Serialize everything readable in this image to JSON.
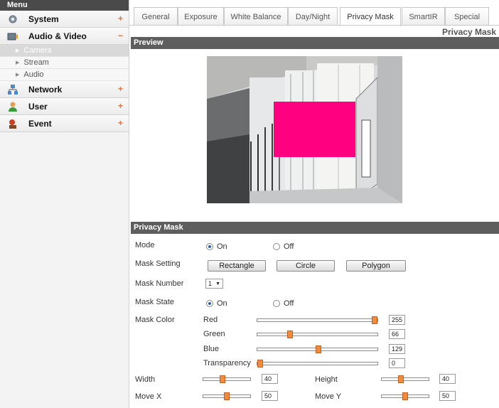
{
  "menu": {
    "header": "Menu",
    "categories": [
      {
        "label": "System",
        "toggle": "+"
      },
      {
        "label": "Audio & Video",
        "toggle": "−"
      },
      {
        "label": "Network",
        "toggle": "+"
      },
      {
        "label": "User",
        "toggle": "+"
      },
      {
        "label": "Event",
        "toggle": "+"
      }
    ],
    "sub_items": [
      {
        "label": "Camera",
        "active": true
      },
      {
        "label": "Stream",
        "active": false
      },
      {
        "label": "Audio",
        "active": false
      }
    ]
  },
  "tabs": [
    {
      "label": "General",
      "active": false
    },
    {
      "label": "Exposure",
      "active": false
    },
    {
      "label": "White Balance",
      "active": false
    },
    {
      "label": "Day/Night",
      "active": false
    },
    {
      "label": "Privacy Mask",
      "active": true
    },
    {
      "label": "SmartIR",
      "active": false
    },
    {
      "label": "Special",
      "active": false
    }
  ],
  "page_title": "Privacy Mask",
  "preview": {
    "title": "Preview",
    "mask_color": "#ff0080"
  },
  "privacy_mask": {
    "title": "Privacy Mask",
    "mode": {
      "label": "Mode",
      "on_label": "On",
      "off_label": "Off",
      "selected": "On"
    },
    "mask_setting": {
      "label": "Mask Setting",
      "buttons": [
        "Rectangle",
        "Circle",
        "Polygon"
      ]
    },
    "mask_number": {
      "label": "Mask Number",
      "value": "1"
    },
    "mask_state": {
      "label": "Mask State",
      "on_label": "On",
      "off_label": "Off",
      "selected": "On"
    },
    "mask_color": {
      "label": "Mask Color",
      "channels": [
        {
          "label": "Red",
          "value": "255",
          "fraction": 1.0
        },
        {
          "label": "Green",
          "value": "66",
          "fraction": 0.26
        },
        {
          "label": "Blue",
          "value": "129",
          "fraction": 0.51
        },
        {
          "label": "Transparency",
          "value": "0",
          "fraction": 0.0
        }
      ]
    },
    "width": {
      "label": "Width",
      "value": "40",
      "fraction": 0.4
    },
    "height": {
      "label": "Height",
      "value": "40",
      "fraction": 0.4
    },
    "move_x": {
      "label": "Move X",
      "value": "50",
      "fraction": 0.5
    },
    "move_y": {
      "label": "Move Y",
      "value": "50",
      "fraction": 0.5
    }
  },
  "colors": {
    "accent": "#f08a3c",
    "section_bar": "#5e5e5e",
    "mask": "#ff0080"
  }
}
